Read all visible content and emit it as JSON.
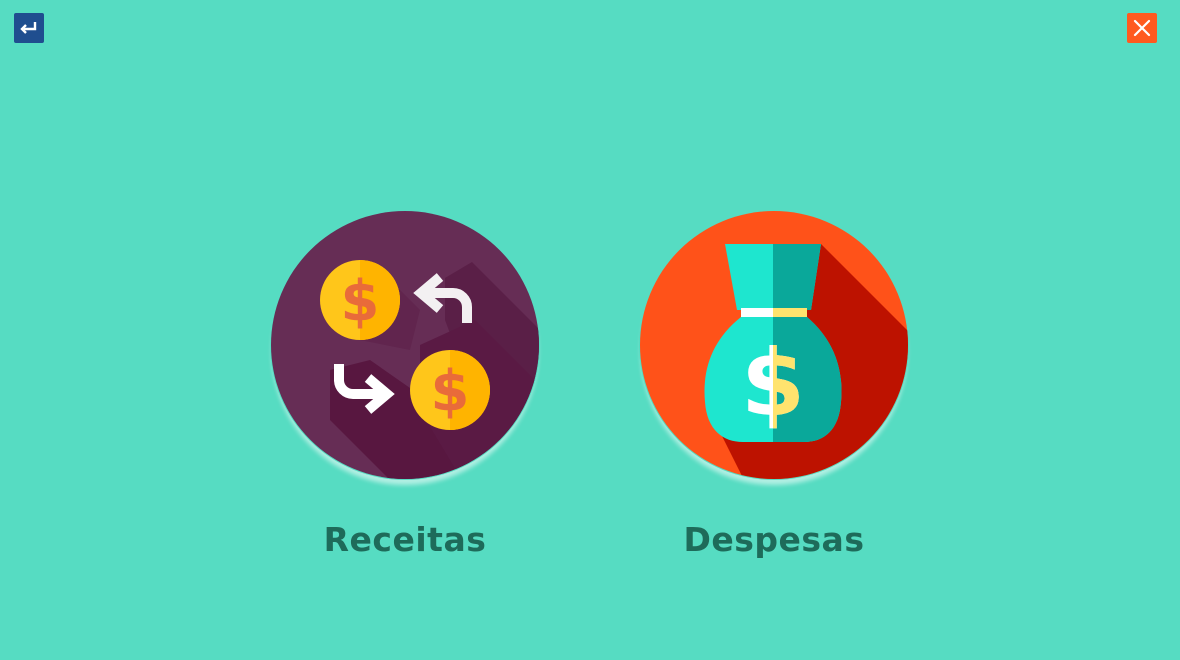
{
  "topbar": {
    "back_icon": "return-arrow-icon",
    "close_icon": "close-icon",
    "back_color": "#1f4e8f",
    "close_color": "#ff5a1f"
  },
  "options": [
    {
      "label": "Receitas",
      "icon": "money-exchange-icon",
      "circle_color": "#662d55"
    },
    {
      "label": "Despesas",
      "icon": "money-bag-icon",
      "circle_color": "#ff5219"
    }
  ],
  "colors": {
    "background": "#56dcc2",
    "label_text": "#1e6b5a"
  }
}
